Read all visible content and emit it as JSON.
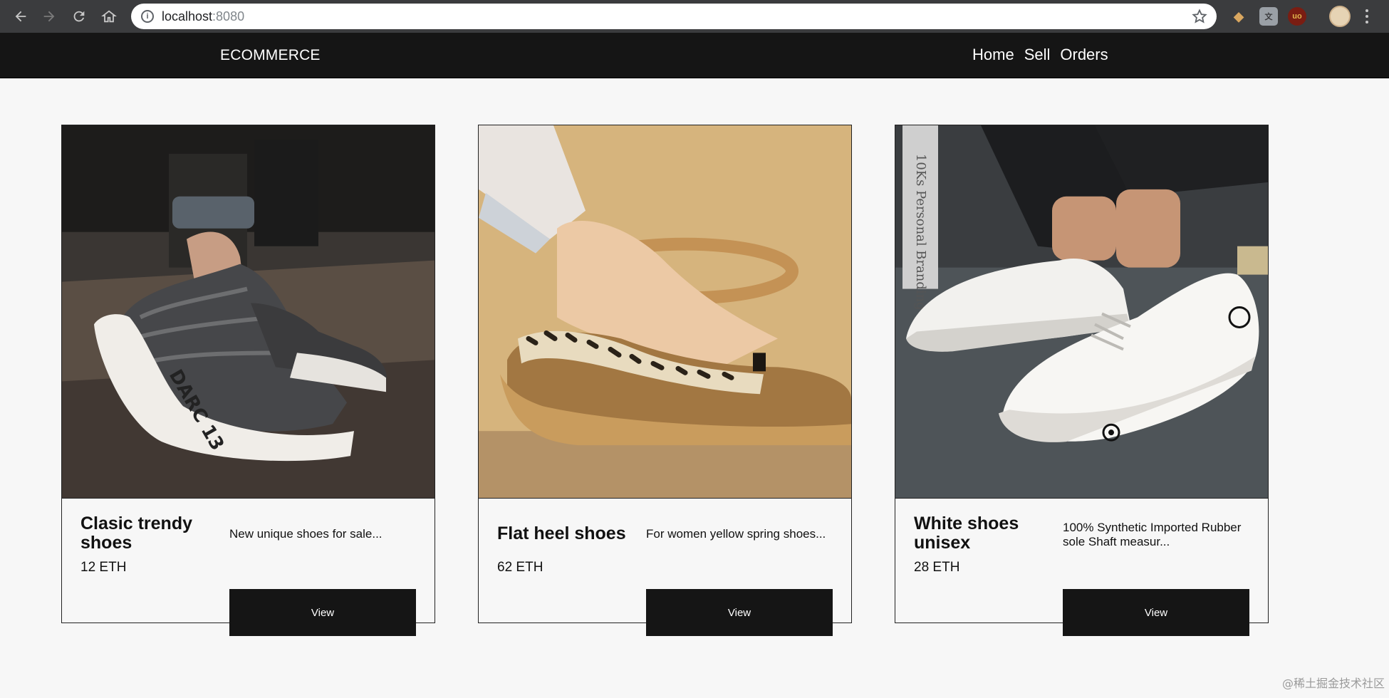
{
  "browser": {
    "url_host": "localhost",
    "url_port": ":8080",
    "icons": [
      "back-icon",
      "forward-icon",
      "reload-icon",
      "home-icon",
      "info-icon",
      "star-icon",
      "profile-avatar",
      "menu-icon"
    ]
  },
  "header": {
    "brand": "ECOMMERCE",
    "nav": [
      {
        "label": "Home"
      },
      {
        "label": "Sell"
      },
      {
        "label": "Orders"
      }
    ]
  },
  "products": [
    {
      "name": "Clasic trendy shoes",
      "price": "12 ETH",
      "description": "New unique shoes for sale...",
      "button": "View",
      "image": "gray knit sneaker"
    },
    {
      "name": "Flat heel shoes",
      "price": "62 ETH",
      "description": "For women yellow spring shoes...",
      "button": "View",
      "image": "tan loafer with leopard trim"
    },
    {
      "name": "White shoes unisex",
      "price": "28 ETH",
      "description": "100% Synthetic Imported Rubber sole Shaft measur...",
      "button": "View",
      "image": "white canvas sneakers"
    }
  ],
  "watermark": "@稀土掘金技术社区",
  "colors": {
    "header_bg": "#151515",
    "page_bg": "#f7f7f7",
    "button_bg": "#151515"
  }
}
